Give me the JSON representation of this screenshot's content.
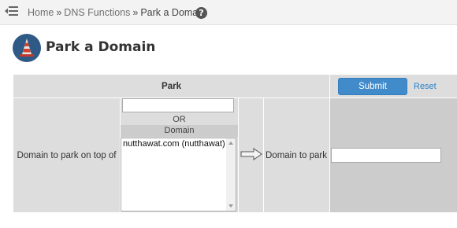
{
  "breadcrumb": {
    "home": "Home",
    "separator": "»",
    "dns_functions": "DNS Functions",
    "current": "Park a Domain",
    "help": "?"
  },
  "page": {
    "title": "Park a Domain"
  },
  "form": {
    "header_label": "Park",
    "submit_label": "Submit",
    "reset_label": "Reset",
    "domain_on_top_label": "Domain to park on top of",
    "custom_domain_value": "",
    "or_label": "OR",
    "domain_list_label": "Domain",
    "domain_options": [
      "nutthawat.com (nutthawat)"
    ],
    "domain_to_park_label": "Domain to park",
    "domain_to_park_value": ""
  },
  "colors": {
    "submit_bg": "#428bca",
    "link": "#2a82c9",
    "row_bg": "#dddddd"
  }
}
